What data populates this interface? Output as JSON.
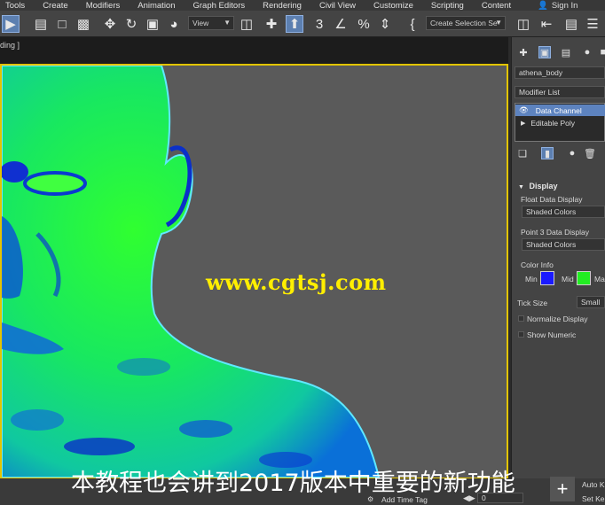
{
  "menu": {
    "items": [
      "Tools",
      "Create",
      "Modifiers",
      "Animation",
      "Graph Editors",
      "Rendering",
      "Civil View",
      "Customize",
      "Scripting",
      "Content"
    ],
    "sign_in": "Sign In"
  },
  "toolbar": {
    "view_dropdown": "View",
    "selection_set_dropdown": "Create Selection Se"
  },
  "viewport": {
    "label_fragment": "ding ]",
    "watermark": "www.cgtsj.com",
    "subtitle": "本教程也会讲到2017版本中重要的新功能"
  },
  "command_panel": {
    "object_name": "athena_body",
    "modifier_list_label": "Modifier List",
    "modifier_stack": [
      "Data Channel",
      "Editable Poly"
    ],
    "display_section": "Display",
    "float_data_display_label": "Float Data Display",
    "float_data_display_value": "Shaded Colors",
    "point3_data_display_label": "Point 3 Data Display",
    "point3_data_display_value": "Shaded Colors",
    "color_info_label": "Color Info",
    "min_label": "Min",
    "mid_label": "Mid",
    "max_label": "Ma",
    "min_color": "#1a1aff",
    "mid_color": "#22ee22",
    "tick_size_label": "Tick Size",
    "tick_size_value": "Small",
    "normalize_display_label": "Normalize Display",
    "show_numeric_label": "Show Numeric"
  },
  "bottom": {
    "add_time_tag": "Add Time Tag",
    "frame_value": "0",
    "auto_key_label": "Auto K",
    "set_key_label": "Set Ke"
  },
  "colors": {
    "selection_highlight": "#5d83bf",
    "viewport_border": "#e2c400",
    "watermark": "#ffee00"
  }
}
